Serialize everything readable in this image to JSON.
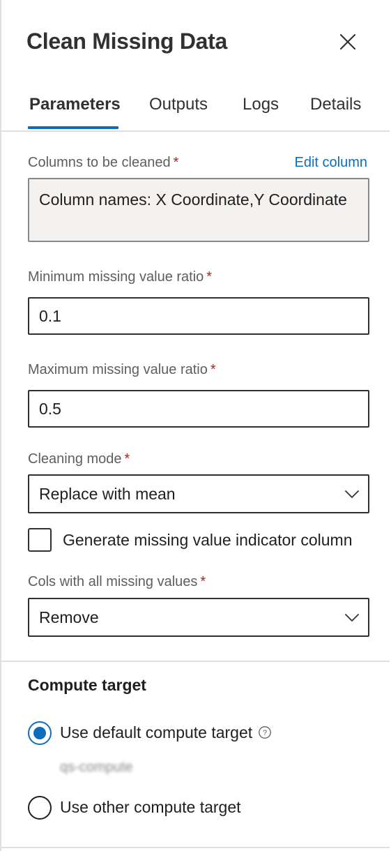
{
  "panel": {
    "title": "Clean Missing Data"
  },
  "tabs": [
    {
      "label": "Parameters",
      "active": true
    },
    {
      "label": "Outputs",
      "active": false
    },
    {
      "label": "Logs",
      "active": false
    },
    {
      "label": "Details",
      "active": false
    }
  ],
  "columns": {
    "label": "Columns to be cleaned",
    "required": "*",
    "edit_link": "Edit column",
    "value": "Column names: X Coordinate,Y Coordinate"
  },
  "min_ratio": {
    "label": "Minimum missing value ratio",
    "required": "*",
    "value": "0.1"
  },
  "max_ratio": {
    "label": "Maximum missing value ratio",
    "required": "*",
    "value": "0.5"
  },
  "cleaning_mode": {
    "label": "Cleaning mode",
    "required": "*",
    "value": "Replace with mean"
  },
  "indicator": {
    "label": "Generate missing value indicator column",
    "checked": false
  },
  "cols_missing": {
    "label": "Cols with all missing values",
    "required": "*",
    "value": "Remove"
  },
  "compute": {
    "title": "Compute target",
    "default_option": "Use default compute target",
    "default_value": "qs-compute",
    "other_option": "Use other compute target",
    "selected": "default"
  },
  "colors": {
    "accent": "#0f6cbd",
    "required": "#a4262c",
    "label": "#605e5c"
  },
  "icons": {
    "close": "close-icon",
    "chevron": "chevron-down-icon",
    "help": "help-circle-icon"
  }
}
